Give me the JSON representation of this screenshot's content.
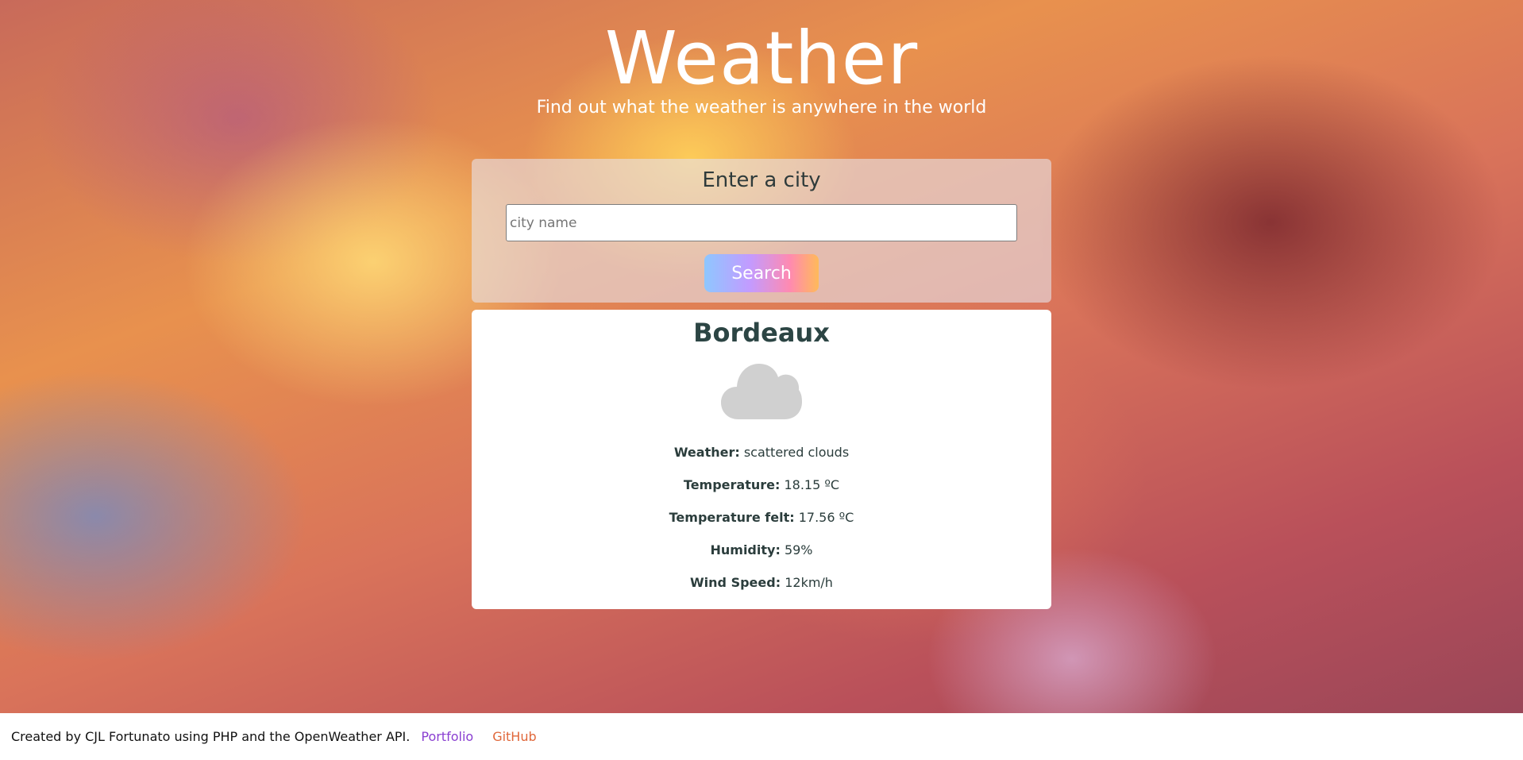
{
  "header": {
    "title": "Weather",
    "subtitle": "Find out what the weather is anywhere in the world"
  },
  "search": {
    "heading": "Enter a city",
    "placeholder": "city name",
    "value": "",
    "button_label": "Search"
  },
  "result": {
    "city": "Bordeaux",
    "icon": "cloud-icon",
    "details": [
      {
        "label": "Weather:",
        "value": "scattered clouds"
      },
      {
        "label": "Temperature:",
        "value": "18.15 ºC"
      },
      {
        "label": "Temperature felt:",
        "value": "17.56 ºC"
      },
      {
        "label": "Humidity:",
        "value": "59%"
      },
      {
        "label": "Wind Speed:",
        "value": "12km/h"
      }
    ]
  },
  "footer": {
    "credit": "Created by CJL Fortunato using PHP and the OpenWeather API.",
    "links": [
      {
        "label": "Portfolio",
        "color": "#8a3fd1"
      },
      {
        "label": "GitHub",
        "color": "#e0673a"
      }
    ]
  },
  "colors": {
    "text_dark": "#2b3d3c",
    "button_gradient": [
      "#8ec7ff",
      "#c39bff",
      "#ff8ab0",
      "#ffba5a"
    ]
  }
}
